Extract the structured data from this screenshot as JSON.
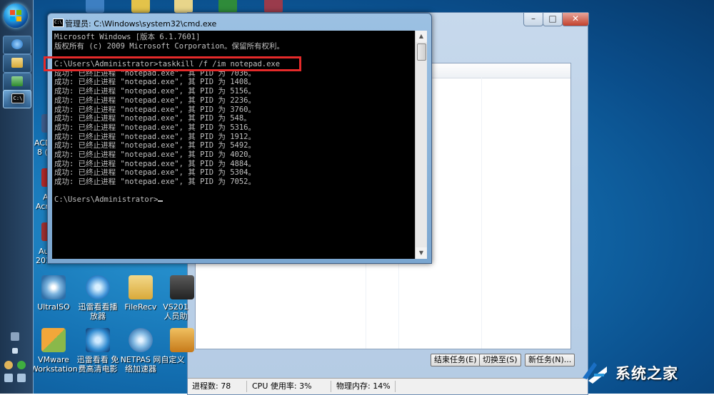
{
  "cmd": {
    "title": "管理员: C:\\Windows\\system32\\cmd.exe",
    "lines": [
      "Microsoft Windows [版本 6.1.7601]",
      "版权所有 (c) 2009 Microsoft Corporation。保留所有权利。",
      "",
      "C:\\Users\\Administrator>taskkill /f /im notepad.exe",
      "成功: 已终止进程 \"notepad.exe\", 其 PID 为 7036。",
      "成功: 已终止进程 \"notepad.exe\", 其 PID 为 1408。",
      "成功: 已终止进程 \"notepad.exe\", 其 PID 为 5156。",
      "成功: 已终止进程 \"notepad.exe\", 其 PID 为 2236。",
      "成功: 已终止进程 \"notepad.exe\", 其 PID 为 3760。",
      "成功: 已终止进程 \"notepad.exe\", 其 PID 为 548。",
      "成功: 已终止进程 \"notepad.exe\", 其 PID 为 5316。",
      "成功: 已终止进程 \"notepad.exe\", 其 PID 为 1912。",
      "成功: 已终止进程 \"notepad.exe\", 其 PID 为 5492。",
      "成功: 已终止进程 \"notepad.exe\", 其 PID 为 4020。",
      "成功: 已终止进程 \"notepad.exe\", 其 PID 为 4884。",
      "成功: 已终止进程 \"notepad.exe\", 其 PID 为 5304。",
      "成功: 已终止进程 \"notepad.exe\", 其 PID 为 7052。",
      "",
      "C:\\Users\\Administrator>"
    ]
  },
  "taskmgr": {
    "buttons": {
      "end_task": "结束任务(E)",
      "switch_to": "切换至(S)",
      "new_task": "新任务(N)..."
    },
    "status": {
      "processes": "进程数: 78",
      "cpu": "CPU 使用率: 3%",
      "memory": "物理内存: 14%"
    }
  },
  "desktop": {
    "left_labels": [
      "ACD",
      "8 (",
      "A",
      "Acr",
      "Au",
      "201"
    ],
    "icons": [
      {
        "label": "UltraISO"
      },
      {
        "label": "迅雷看看播放器"
      },
      {
        "label": "FileRecv"
      },
      {
        "label": "VS201 人员助"
      },
      {
        "label": "VMware Workstation"
      },
      {
        "label": "迅雷看看 免费高清电影"
      },
      {
        "label": "NETPAS 网络加速器"
      },
      {
        "label": "自定义"
      }
    ]
  },
  "watermark": {
    "text": "系统之家"
  }
}
